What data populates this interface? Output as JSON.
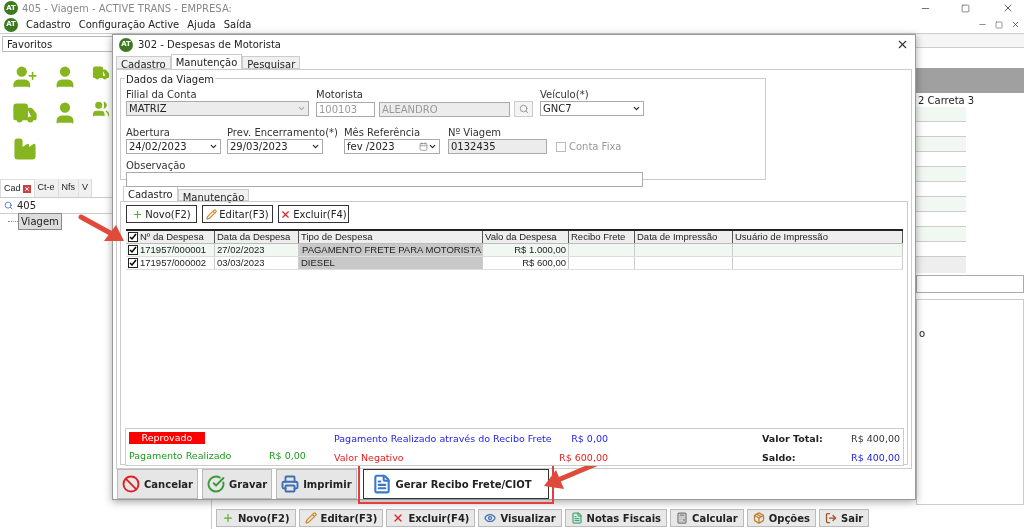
{
  "app": {
    "logo": "AT",
    "menu_logo": "AT",
    "title": "405 - Viagem - ACTIVE TRANS - EMPRESA:",
    "menu": [
      "Cadastro",
      "Configuração Active",
      "Ajuda",
      "Saída"
    ],
    "favorites": "Favoritos",
    "side_tabs": [
      {
        "label": "Cad",
        "selected": true,
        "closable": true
      },
      {
        "label": "Ct-e",
        "selected": false,
        "closable": false
      },
      {
        "label": "Nfs",
        "selected": false,
        "closable": false
      },
      {
        "label": "V",
        "selected": false,
        "closable": false
      }
    ],
    "search_value": "405",
    "tree": [
      {
        "label": "Viagem",
        "selected": true
      }
    ],
    "grid_header": "2 Carreta 3",
    "fragment": "o",
    "toolbar": [
      {
        "label": "Novo(F2)",
        "kind": "new"
      },
      {
        "label": "Editar(F3)",
        "kind": "edit"
      },
      {
        "label": "Excluir(F4)",
        "kind": "delete"
      },
      {
        "label": "Visualizar",
        "kind": "view"
      },
      {
        "label": "Notas Fiscais",
        "kind": "invoices"
      },
      {
        "label": "Calcular",
        "kind": "calc"
      },
      {
        "label": "Opções",
        "kind": "options"
      },
      {
        "label": "Sair",
        "kind": "exit"
      }
    ]
  },
  "dialog": {
    "logo": "AT",
    "title": "302 - Despesas de Motorista",
    "tabs": [
      {
        "label": "Cadastro",
        "selected": false
      },
      {
        "label": "Manutenção",
        "selected": true
      },
      {
        "label": "Pesquisar",
        "selected": false
      }
    ],
    "group_title": "Dados da Viagem",
    "filial": {
      "label": "Filial da Conta",
      "value": "MATRIZ"
    },
    "motorista": {
      "label": "Motorista",
      "code": "100103",
      "name": "ALEANDRO"
    },
    "veiculo": {
      "label": "Veículo(*)",
      "value": "GNC7"
    },
    "abertura": {
      "label": "Abertura",
      "value": "24/02/2023"
    },
    "prev": {
      "label": "Prev. Encerramento(*)",
      "value": "29/03/2023"
    },
    "mes": {
      "label": "Mês Referência",
      "value": "fev /2023"
    },
    "viagem": {
      "label": "Nº Viagem",
      "value": "0132435"
    },
    "conta_fixa": {
      "label": "Conta Fixa",
      "checked": false
    },
    "observacao": {
      "label": "Observação"
    },
    "inner_tabs": [
      {
        "label": "Cadastro",
        "selected": true
      },
      {
        "label": "Manutenção",
        "selected": false
      }
    ],
    "buttons": [
      {
        "label": "Novo(F2)",
        "kind": "new"
      },
      {
        "label": "Editar(F3)",
        "kind": "edit"
      },
      {
        "label": "Excluir(F4)",
        "kind": "delete"
      }
    ],
    "header_checked": true,
    "columns": [
      "Nº da Despesa",
      "Data da Despesa",
      "Tipo de Despesa",
      "Valo da Despesa",
      "Recibo Frete",
      "Data de Impressão",
      "Usuário de Impressão"
    ],
    "rows": [
      {
        "checked": true,
        "selected": true,
        "cells": [
          "171957/000001",
          "27/02/2023",
          "PAGAMENTO FRETE PARA MOTORISTA",
          "R$ 1.000,00",
          "",
          "",
          ""
        ]
      },
      {
        "checked": true,
        "selected": false,
        "cells": [
          "171957/000002",
          "03/03/2023",
          "DIESEL",
          "R$ 600,00",
          "",
          "",
          ""
        ]
      }
    ],
    "status": "Reprovado",
    "summary_left": [
      {
        "label": "Pagamento Realizado",
        "value": "R$ 0,00",
        "kind": "paid"
      }
    ],
    "summary_mid": [
      {
        "label": "Pagamento Realizado através do Recibo Frete",
        "value": "R$ 0,00",
        "kind": "receipt"
      },
      {
        "label": "Valor Negativo",
        "value": "R$ 600,00",
        "kind": "negative"
      }
    ],
    "summary_right": [
      {
        "label": "Valor Total:",
        "value": "R$ 400,00",
        "kind": "total"
      },
      {
        "label": "Saldo:",
        "value": "R$ 400,00",
        "kind": "balance"
      }
    ],
    "actions": [
      {
        "label": "Cancelar",
        "kind": "cancel",
        "highlighted": false
      },
      {
        "label": "Gravar",
        "kind": "save",
        "highlighted": false
      },
      {
        "label": "Imprimir",
        "kind": "print",
        "highlighted": false
      },
      {
        "label": "Gerar Recibo Frete/CIOT",
        "kind": "receipt",
        "highlighted": true
      }
    ]
  }
}
